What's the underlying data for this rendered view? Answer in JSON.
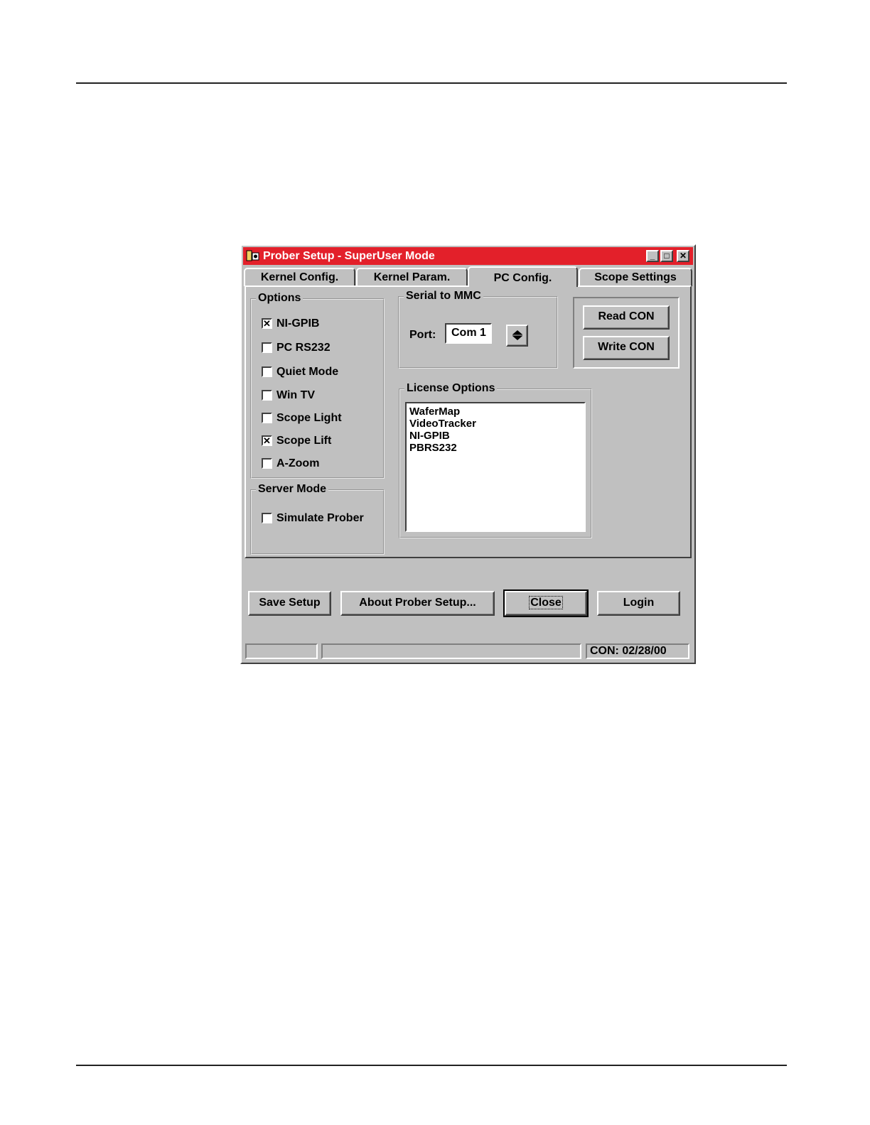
{
  "window": {
    "title": "Prober Setup - SuperUser Mode",
    "title_bar_color": "#e3202a",
    "min_icon": "minimize-icon",
    "max_icon": "maximize-icon",
    "close_icon": "close-icon"
  },
  "tabs": [
    {
      "label": "Kernel Config."
    },
    {
      "label": "Kernel Param."
    },
    {
      "label": "PC Config.",
      "active": true
    },
    {
      "label": "Scope Settings"
    }
  ],
  "options": {
    "label": "Options",
    "items": [
      {
        "label": "NI-GPIB",
        "checked": true
      },
      {
        "label": "PC RS232",
        "checked": false
      },
      {
        "label": "Quiet Mode",
        "checked": false
      },
      {
        "label": "Win TV",
        "checked": false
      },
      {
        "label": "Scope Light",
        "checked": false
      },
      {
        "label": "Scope Lift",
        "checked": true
      },
      {
        "label": "A-Zoom",
        "checked": false
      }
    ]
  },
  "server_mode": {
    "label": "Server Mode",
    "simulate_label": "Simulate Prober",
    "simulate_checked": false
  },
  "serial": {
    "label": "Serial to MMC",
    "port_label": "Port:",
    "port_value": "Com 1"
  },
  "con_buttons": {
    "read": "Read CON",
    "write": "Write CON"
  },
  "license": {
    "label": "License Options",
    "items": [
      "WaferMap",
      "VideoTracker",
      "NI-GPIB",
      "PBRS232"
    ]
  },
  "footer": {
    "save": "Save Setup",
    "about": "About Prober Setup...",
    "close": "Close",
    "login": "Login"
  },
  "status": {
    "con": "CON: 02/28/00"
  }
}
